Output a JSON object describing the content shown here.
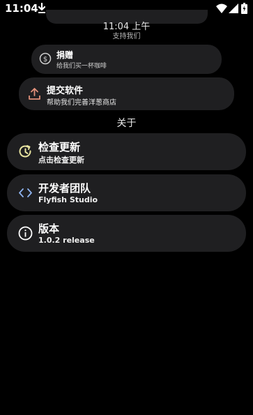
{
  "status_bar": {
    "time": "11:04",
    "icons": [
      "download-icon",
      "wifi-icon",
      "signal-icon",
      "battery-icon"
    ]
  },
  "header": {
    "clock": "11:04 上午",
    "support_label": "支持我们"
  },
  "donate": {
    "title": "捐赠",
    "subtitle": "给我们买一杯咖啡",
    "icon": "dollar-circle-icon"
  },
  "submit": {
    "title": "提交软件",
    "subtitle": "帮助我们完善洋葱商店",
    "icon": "upload-icon"
  },
  "about": {
    "section_title": "关于",
    "items": [
      {
        "title": "检查更新",
        "subtitle": "点击检查更新",
        "icon": "update-icon"
      },
      {
        "title": "开发者团队",
        "subtitle": "Flyfish Studio",
        "icon": "code-icon"
      },
      {
        "title": "版本",
        "subtitle": "1.0.2 release",
        "icon": "info-icon"
      }
    ]
  },
  "colors": {
    "background": "#000000",
    "card": "#1f1f21",
    "update_accent": "#e8e4a0",
    "code_accent": "#8fb4f0",
    "upload_accent": "#e0907a"
  }
}
